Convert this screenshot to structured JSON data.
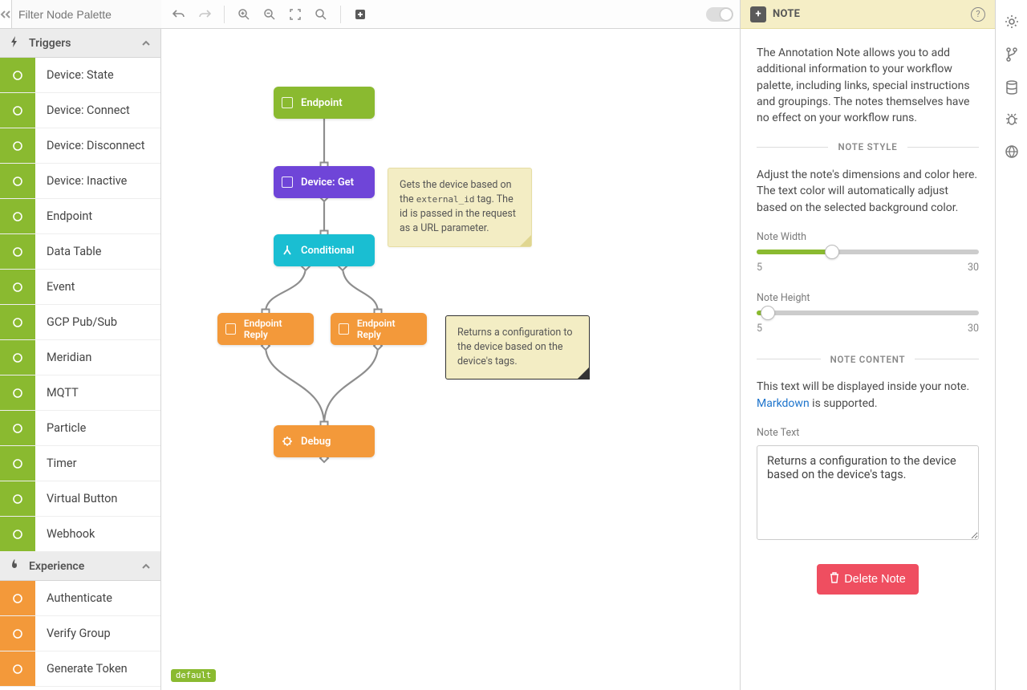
{
  "search": {
    "placeholder": "Filter Node Palette"
  },
  "sections": {
    "triggers": {
      "label": "Triggers"
    },
    "experience": {
      "label": "Experience"
    }
  },
  "palette": {
    "triggers": [
      "Device: State",
      "Device: Connect",
      "Device: Disconnect",
      "Device: Inactive",
      "Endpoint",
      "Data Table",
      "Event",
      "GCP Pub/Sub",
      "Meridian",
      "MQTT",
      "Particle",
      "Timer",
      "Virtual Button",
      "Webhook"
    ],
    "experience": [
      "Authenticate",
      "Verify Group",
      "Generate Token"
    ]
  },
  "nodes": {
    "endpoint": "Endpoint",
    "device_get": "Device: Get",
    "conditional": "Conditional",
    "endpoint_reply_l": "Endpoint Reply",
    "endpoint_reply_r": "Endpoint Reply",
    "debug": "Debug"
  },
  "stickies": {
    "a_pre": "Gets the device based on the ",
    "a_code": "external_id",
    "a_post": " tag. The id is passed in the request as a URL parameter.",
    "b": "Returns a configuration to the device based on the device's tags."
  },
  "badge": "default",
  "panel": {
    "title": "NOTE",
    "intro": "The Annotation Note allows you to add additional information to your workflow palette, including links, special instructions and groupings. The notes themselves have no effect on your workflow runs.",
    "style": {
      "heading": "NOTE STYLE",
      "desc": "Adjust the note's dimensions and color here. The text color will automatically adjust based on the selected background color.",
      "width_label": "Note Width",
      "height_label": "Note Height",
      "min": "5",
      "max": "30"
    },
    "content": {
      "heading": "NOTE CONTENT",
      "desc_pre": "This text will be displayed inside your note. ",
      "desc_link": "Markdown",
      "desc_post": " is supported.",
      "text_label": "Note Text",
      "text_value": "Returns a configuration to the device based on the device's tags."
    },
    "delete": "Delete Note"
  }
}
